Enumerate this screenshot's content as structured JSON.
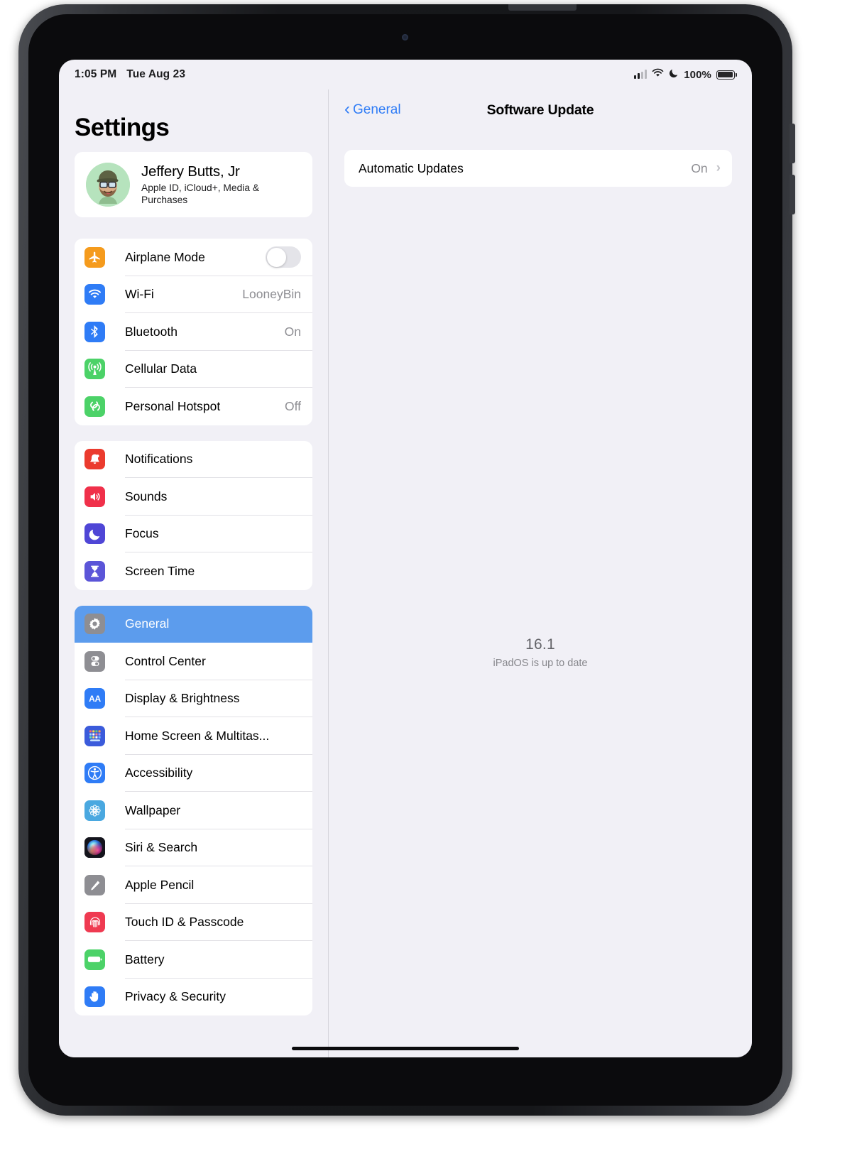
{
  "status_bar": {
    "time": "1:05 PM",
    "date": "Tue Aug 23",
    "battery_percent": "100%",
    "icons": [
      "cellular-signal-icon",
      "wifi-icon",
      "do-not-disturb-moon-icon",
      "battery-icon"
    ]
  },
  "sidebar": {
    "title": "Settings",
    "profile": {
      "name": "Jeffery Butts, Jr",
      "subtitle": "Apple ID, iCloud+, Media & Purchases",
      "avatar_background": "#b6e3bd"
    },
    "groups": [
      {
        "id": "connectivity",
        "items": [
          {
            "label": "Airplane Mode",
            "icon": "airplane-icon",
            "icon_color": "#f59b1d",
            "control": "toggle",
            "toggle_on": false
          },
          {
            "label": "Wi-Fi",
            "icon": "wifi-icon",
            "icon_color": "#2f7cf6",
            "value": "LooneyBin"
          },
          {
            "label": "Bluetooth",
            "icon": "bluetooth-icon",
            "icon_color": "#2f7cf6",
            "value": "On"
          },
          {
            "label": "Cellular Data",
            "icon": "cellular-antenna-icon",
            "icon_color": "#4cd268",
            "value": ""
          },
          {
            "label": "Personal Hotspot",
            "icon": "hotspot-link-icon",
            "icon_color": "#4cd268",
            "value": "Off"
          }
        ]
      },
      {
        "id": "alerts",
        "items": [
          {
            "label": "Notifications",
            "icon": "bell-icon",
            "icon_color": "#eb3b2e",
            "value": ""
          },
          {
            "label": "Sounds",
            "icon": "speaker-icon",
            "icon_color": "#f0304a",
            "value": ""
          },
          {
            "label": "Focus",
            "icon": "moon-icon",
            "icon_color": "#4f46d6",
            "value": ""
          },
          {
            "label": "Screen Time",
            "icon": "hourglass-icon",
            "icon_color": "#5b55d8",
            "value": ""
          }
        ]
      },
      {
        "id": "system",
        "items": [
          {
            "label": "General",
            "icon": "gear-icon",
            "icon_color": "#8e8e93",
            "value": "",
            "selected": true
          },
          {
            "label": "Control Center",
            "icon": "control-center-icon",
            "icon_color": "#8e8e93",
            "value": ""
          },
          {
            "label": "Display & Brightness",
            "icon": "display-aa-icon",
            "icon_color": "#2f7cf6",
            "value": ""
          },
          {
            "label": "Home Screen & Multitas...",
            "icon": "home-screen-grid-icon",
            "icon_color": "#3b5bdb",
            "value": ""
          },
          {
            "label": "Accessibility",
            "icon": "accessibility-icon",
            "icon_color": "#2f7cf6",
            "value": ""
          },
          {
            "label": "Wallpaper",
            "icon": "wallpaper-flower-icon",
            "icon_color": "#4aa8e0",
            "value": ""
          },
          {
            "label": "Siri & Search",
            "icon": "siri-orb-icon",
            "icon_color": "#1c1c22",
            "value": ""
          },
          {
            "label": "Apple Pencil",
            "icon": "pencil-icon",
            "icon_color": "#8e8e93",
            "value": ""
          },
          {
            "label": "Touch ID & Passcode",
            "icon": "fingerprint-icon",
            "icon_color": "#ef3a51",
            "value": ""
          },
          {
            "label": "Battery",
            "icon": "battery-icon",
            "icon_color": "#4cd268",
            "value": ""
          },
          {
            "label": "Privacy & Security",
            "icon": "hand-raised-icon",
            "icon_color": "#2f7cf6",
            "value": ""
          }
        ]
      }
    ]
  },
  "detail": {
    "back_label": "General",
    "title": "Software Update",
    "automatic_updates": {
      "label": "Automatic Updates",
      "value": "On"
    },
    "version_number": "16.1",
    "version_status": "iPadOS is up to date"
  },
  "colors": {
    "accent_blue": "#2f7cf6",
    "selected_row": "#5c9ced",
    "page_background": "#f1f0f6",
    "card_background": "#ffffff",
    "secondary_text": "#8e8e93"
  }
}
